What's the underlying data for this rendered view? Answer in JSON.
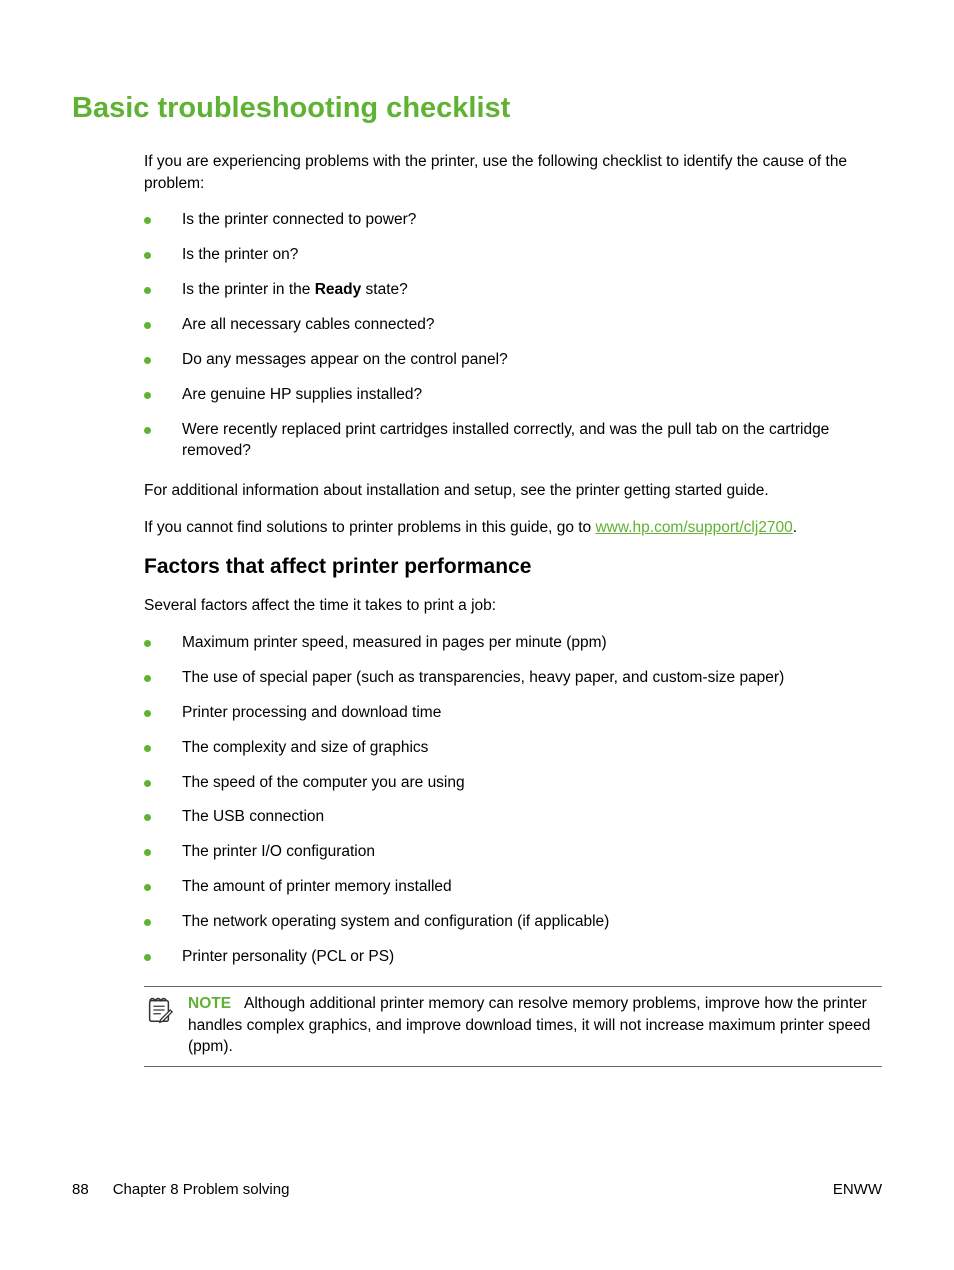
{
  "title": "Basic troubleshooting checklist",
  "intro": "If you are experiencing problems with the printer, use the following checklist to identify the cause of the problem:",
  "checklist": [
    {
      "text": "Is the printer connected to power?"
    },
    {
      "text": "Is the printer on?"
    },
    {
      "pre": "Is the printer in the ",
      "bold": "Ready",
      "post": " state?"
    },
    {
      "text": "Are all necessary cables connected?"
    },
    {
      "text": "Do any messages appear on the control panel?"
    },
    {
      "text": "Are genuine HP supplies installed?"
    },
    {
      "text": "Were recently replaced print cartridges installed correctly, and was the pull tab on the cartridge removed?"
    }
  ],
  "after1": "For additional information about installation and setup, see the printer getting started guide.",
  "after2_pre": "If you cannot find solutions to printer problems in this guide, go to ",
  "after2_link": "www.hp.com/support/clj2700",
  "after2_post": ".",
  "section2_title": "Factors that affect printer performance",
  "section2_intro": "Several factors affect the time it takes to print a job:",
  "factors": [
    "Maximum printer speed, measured in pages per minute (ppm)",
    "The use of special paper (such as transparencies, heavy paper, and custom-size paper)",
    "Printer processing and download time",
    "The complexity and size of graphics",
    "The speed of the computer you are using",
    "The USB connection",
    "The printer I/O configuration",
    "The amount of printer memory installed",
    "The network operating system and configuration (if applicable)",
    "Printer personality (PCL or PS)"
  ],
  "note_label": "NOTE",
  "note_text": "Although additional printer memory can resolve memory problems, improve how the printer handles complex graphics, and improve download times, it will not increase maximum printer speed (ppm).",
  "footer": {
    "page": "88",
    "chapter": "Chapter 8   Problem solving",
    "right": "ENWW"
  }
}
